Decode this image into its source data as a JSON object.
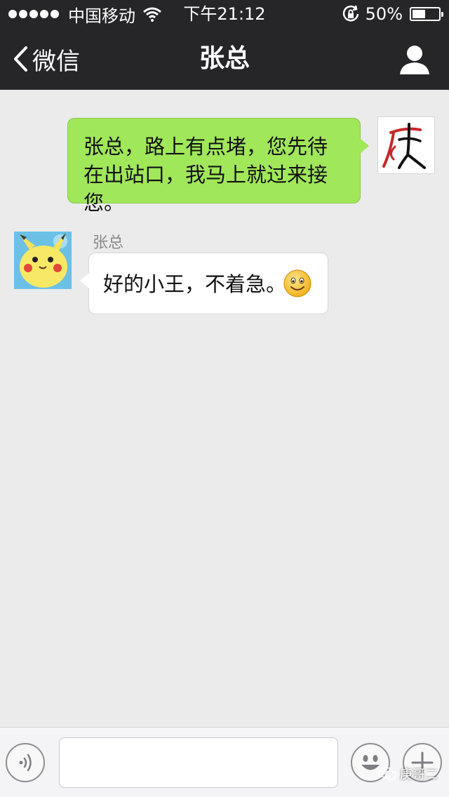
{
  "status_bar": {
    "carrier": "中国移动",
    "time": "下午21:12",
    "battery_text": "50%",
    "battery_level": 0.5,
    "icons": [
      "signal-dots-icon",
      "wifi-icon",
      "orientation-lock-icon",
      "battery-icon"
    ]
  },
  "nav": {
    "back_label": "微信",
    "title": "张总",
    "contact_icon": "person-icon"
  },
  "messages": [
    {
      "direction": "outgoing",
      "text": "张总，路上有点堵，您先待在出站口，我马上就过来接您。",
      "avatar": "avatar-calligraphy"
    },
    {
      "direction": "incoming",
      "sender": "张总",
      "text": "好的小王，不着急。",
      "emoji": "smile-emoji",
      "avatar": "avatar-pikachu"
    }
  ],
  "input_bar": {
    "voice_icon": "voice-icon",
    "emoji_icon": "emoji-face-icon",
    "plus_icon": "plus-icon",
    "text_value": ""
  },
  "watermark": {
    "text": "庚哥二"
  },
  "colors": {
    "nav_bg": "#262628",
    "chat_bg": "#ebebeb",
    "outgoing_bubble": "#a0e75a",
    "incoming_bubble": "#ffffff"
  }
}
